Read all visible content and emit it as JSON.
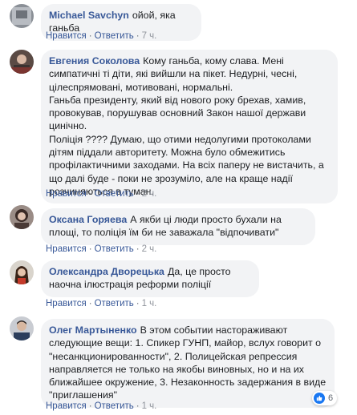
{
  "comments": [
    {
      "author": "Michael Savchyn",
      "text": [
        "ойой, яка ганьба"
      ],
      "actions": {
        "like": "Нравится",
        "reply": "Ответить",
        "time": "7 ч."
      }
    },
    {
      "author": "Евгения Соколова",
      "text": [
        "Кому ганьба, кому слава. Мені симпатичні ті діти, які вийшли на пікет. Недурні, чесні, цілеспрямовані, мотивовані, нормальні.",
        "Ганьба президенту, який від нового року брехав, хамив, провокував, порушував основний Закон нашої держави цинічно.",
        "Поліція ???? Думаю, що отими недолугими протоколами дітям піддали авторитету. Можна було обмежитись профілактичними заходами. На всіх паперу не вистачить, а що далі буде - поки не зрозуміло, але на краще надії розчиняються в туман."
      ],
      "actions": {
        "like": "Нравится",
        "reply": "Ответить",
        "time": "2 ч."
      }
    },
    {
      "author": "Оксана Горяева",
      "text": [
        "А якби ці люди просто бухали на площі, то поліція їм би не заважала \"відпочивати\""
      ],
      "actions": {
        "like": "Нравится",
        "reply": "Ответить",
        "time": "2 ч."
      }
    },
    {
      "author": "Олександра Дворецька",
      "text": [
        "Да, це просто наочна ілюстрація реформи поліції"
      ],
      "actions": {
        "like": "Нравится",
        "reply": "Ответить",
        "time": "1 ч."
      }
    },
    {
      "author": "Олег Мартыненко",
      "text": [
        "В этом событии настораживают следующие вещи: 1. Спикер ГУНП, майор, вслух говорит о \"несанкционированности\", 2. Полицейская репрессия направляется не только на якобы виновных, но и на их ближайшее окружение, 3. Незаконность задержания в виде \"приглашения\""
      ],
      "actions": {
        "like": "Нравится",
        "reply": "Ответить",
        "time": "1 ч."
      },
      "reactions": {
        "icon": "like-icon",
        "count": "6"
      }
    }
  ],
  "colors": {
    "author": "#385898",
    "bubble": "#f2f3f5",
    "like": "#1877f2",
    "meta": "#606770"
  }
}
